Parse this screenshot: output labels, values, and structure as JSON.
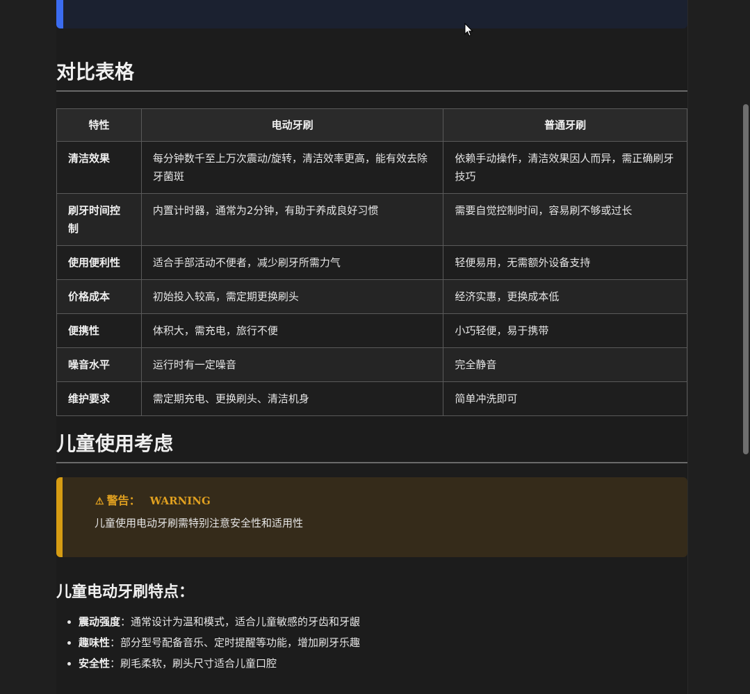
{
  "top_callout": {
    "cut_text": "……"
  },
  "compare": {
    "heading": "对比表格",
    "headers": [
      "特性",
      "电动牙刷",
      "普通牙刷"
    ],
    "rows": [
      {
        "feature": "清洁效果",
        "electric": "每分钟数千至上万次震动/旋转，清洁效率更高，能有效去除牙菌斑",
        "manual": "依赖手动操作，清洁效果因人而异，需正确刷牙技巧"
      },
      {
        "feature": "刷牙时间控制",
        "electric": "内置计时器，通常为2分钟，有助于养成良好习惯",
        "manual": "需要自觉控制时间，容易刷不够或过长"
      },
      {
        "feature": "使用便利性",
        "electric": "适合手部活动不便者，减少刷牙所需力气",
        "manual": "轻便易用，无需额外设备支持"
      },
      {
        "feature": "价格成本",
        "electric": "初始投入较高，需定期更换刷头",
        "manual": "经济实惠，更换成本低"
      },
      {
        "feature": "便携性",
        "electric": "体积大，需充电，旅行不便",
        "manual": "小巧轻便，易于携带"
      },
      {
        "feature": "噪音水平",
        "electric": "运行时有一定噪音",
        "manual": "完全静音"
      },
      {
        "feature": "维护要求",
        "electric": "需定期充电、更换刷头、清洁机身",
        "manual": "简单冲洗即可"
      }
    ]
  },
  "kids": {
    "heading": "儿童使用考虑",
    "warning": {
      "icon": "⚠",
      "title": "警告：",
      "title_en": "WARNING",
      "text": "儿童使用电动牙刷需特别注意安全性和适用性"
    },
    "sub_heading": "儿童电动牙刷特点：",
    "features": [
      {
        "label": "震动强度",
        "text": "：通常设计为温和模式，适合儿童敏感的牙齿和牙龈"
      },
      {
        "label": "趣味性",
        "text": "：部分型号配备音乐、定时提醒等功能，增加刷牙乐趣"
      },
      {
        "label": "安全性",
        "text": "：刷毛柔软，刷头尺寸适合儿童口腔"
      }
    ]
  },
  "colors": {
    "info_accent": "#3b6cf0",
    "warning_accent": "#d69c13",
    "warning_bg": "#352b1a"
  }
}
